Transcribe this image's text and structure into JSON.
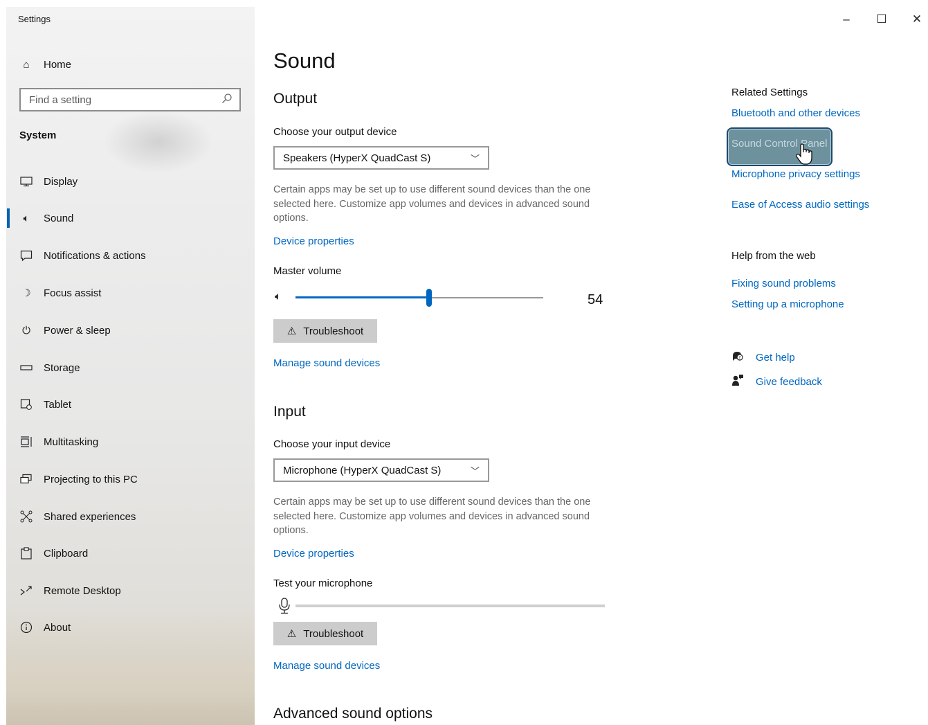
{
  "window": {
    "title": "Settings",
    "controls": {
      "minimize": "–",
      "maximize": "☐",
      "close": "✕"
    }
  },
  "sidebar": {
    "home_label": "Home",
    "search_placeholder": "Find a setting",
    "section_label": "System",
    "items": [
      {
        "label": "Display",
        "icon": "monitor-icon"
      },
      {
        "label": "Sound",
        "icon": "speaker-icon",
        "active": true
      },
      {
        "label": "Notifications & actions",
        "icon": "notification-icon"
      },
      {
        "label": "Focus assist",
        "icon": "moon-icon"
      },
      {
        "label": "Power & sleep",
        "icon": "power-icon"
      },
      {
        "label": "Storage",
        "icon": "storage-icon"
      },
      {
        "label": "Tablet",
        "icon": "tablet-icon"
      },
      {
        "label": "Multitasking",
        "icon": "multitasking-icon"
      },
      {
        "label": "Projecting to this PC",
        "icon": "projecting-icon"
      },
      {
        "label": "Shared experiences",
        "icon": "shared-icon"
      },
      {
        "label": "Clipboard",
        "icon": "clipboard-icon"
      },
      {
        "label": "Remote Desktop",
        "icon": "remote-desktop-icon"
      },
      {
        "label": "About",
        "icon": "info-icon"
      }
    ],
    "accent": "#0063b1"
  },
  "main": {
    "title": "Sound",
    "output": {
      "heading": "Output",
      "device_label": "Choose your output device",
      "device_value": "Speakers (HyperX QuadCast S)",
      "description": "Certain apps may be set up to use different sound devices than the one selected here. Customize app volumes and devices in advanced sound options.",
      "device_properties": "Device properties",
      "volume_label": "Master volume",
      "volume_value": "54",
      "troubleshoot": "Troubleshoot",
      "manage": "Manage sound devices"
    },
    "input": {
      "heading": "Input",
      "device_label": "Choose your input device",
      "device_value": "Microphone (HyperX QuadCast S)",
      "description": "Certain apps may be set up to use different sound devices than the one selected here. Customize app volumes and devices in advanced sound options.",
      "device_properties": "Device properties",
      "test_label": "Test your microphone",
      "troubleshoot": "Troubleshoot",
      "manage": "Manage sound devices"
    },
    "advanced_heading": "Advanced sound options"
  },
  "related": {
    "heading": "Related Settings",
    "links": {
      "bluetooth": "Bluetooth and other devices",
      "sound_control_panel": "Sound Control Panel",
      "mic_privacy": "Microphone privacy settings",
      "ease_audio": "Ease of Access audio settings"
    },
    "help_heading": "Help from the web",
    "help_links": {
      "fixing": "Fixing sound problems",
      "setup_mic": "Setting up a microphone"
    },
    "get_help": "Get help",
    "give_feedback": "Give feedback"
  },
  "colors": {
    "link": "#0067c0",
    "slider": "#0067c0",
    "focus_highlight": "#6d919d"
  }
}
